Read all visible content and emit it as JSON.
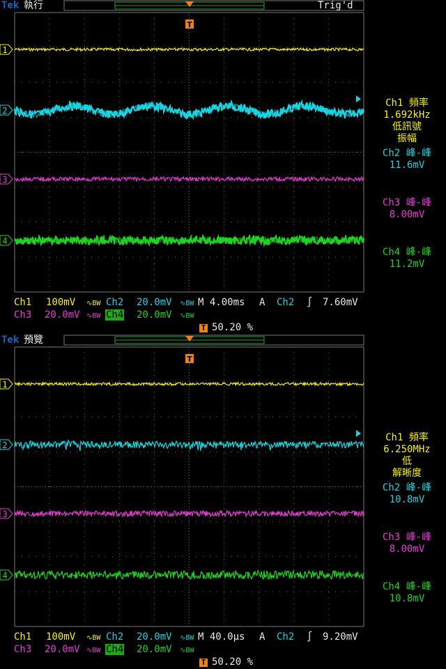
{
  "screens": [
    {
      "logo": "Tek",
      "mode": "執行",
      "status": "Trig'd",
      "trigger_marker": "T",
      "readouts": [
        {
          "channel": "Ch1",
          "label": "頻率",
          "lines": [
            "1.692kHz",
            "低訊號",
            "振幅"
          ],
          "color": "#f7f205"
        },
        {
          "channel": "Ch2",
          "label": "峰-峰",
          "lines": [
            "11.6mV"
          ],
          "color": "#18d4e0"
        },
        {
          "channel": "Ch3",
          "label": "峰-峰",
          "lines": [
            "8.00mV"
          ],
          "color": "#e83ad8"
        },
        {
          "channel": "Ch4",
          "label": "峰-峰",
          "lines": [
            "11.2mV"
          ],
          "color": "#1fd420"
        }
      ],
      "ch1_label": "Ch1",
      "ch1_scale": "100mV",
      "ch2_label": "Ch2",
      "ch2_scale": "20.0mV",
      "ch3_label": "Ch3",
      "ch3_scale": "20.0mV",
      "ch4_label": "Ch4",
      "ch4_scale": "20.0mV",
      "coupling": "∿BW",
      "timebase": "M 4.00ms",
      "acq": "A",
      "trig_source": "Ch2",
      "trig_slope": "∫",
      "trig_level": "7.60mV",
      "trig_position": "50.20 %"
    },
    {
      "logo": "Tek",
      "mode": "預覽",
      "status": "",
      "trigger_marker": "T",
      "readouts": [
        {
          "channel": "Ch1",
          "label": "頻率",
          "lines": [
            "6.250MHz",
            "低",
            "解晰度"
          ],
          "color": "#f7f205"
        },
        {
          "channel": "Ch2",
          "label": "峰-峰",
          "lines": [
            "10.8mV"
          ],
          "color": "#18d4e0"
        },
        {
          "channel": "Ch3",
          "label": "峰-峰",
          "lines": [
            "8.00mV"
          ],
          "color": "#e83ad8"
        },
        {
          "channel": "Ch4",
          "label": "峰-峰",
          "lines": [
            "10.8mV"
          ],
          "color": "#1fd420"
        }
      ],
      "ch1_label": "Ch1",
      "ch1_scale": "100mV",
      "ch2_label": "Ch2",
      "ch2_scale": "20.0mV",
      "ch3_label": "Ch3",
      "ch3_scale": "20.0mV",
      "ch4_label": "Ch4",
      "ch4_scale": "20.0mV",
      "coupling": "∿BW",
      "timebase": "M 40.0µs",
      "acq": "A",
      "trig_source": "Ch2",
      "trig_slope": "∫",
      "trig_level": "9.20mV",
      "trig_position": "50.20 %"
    }
  ],
  "channel_markers": [
    "1",
    "2",
    "3",
    "4"
  ]
}
